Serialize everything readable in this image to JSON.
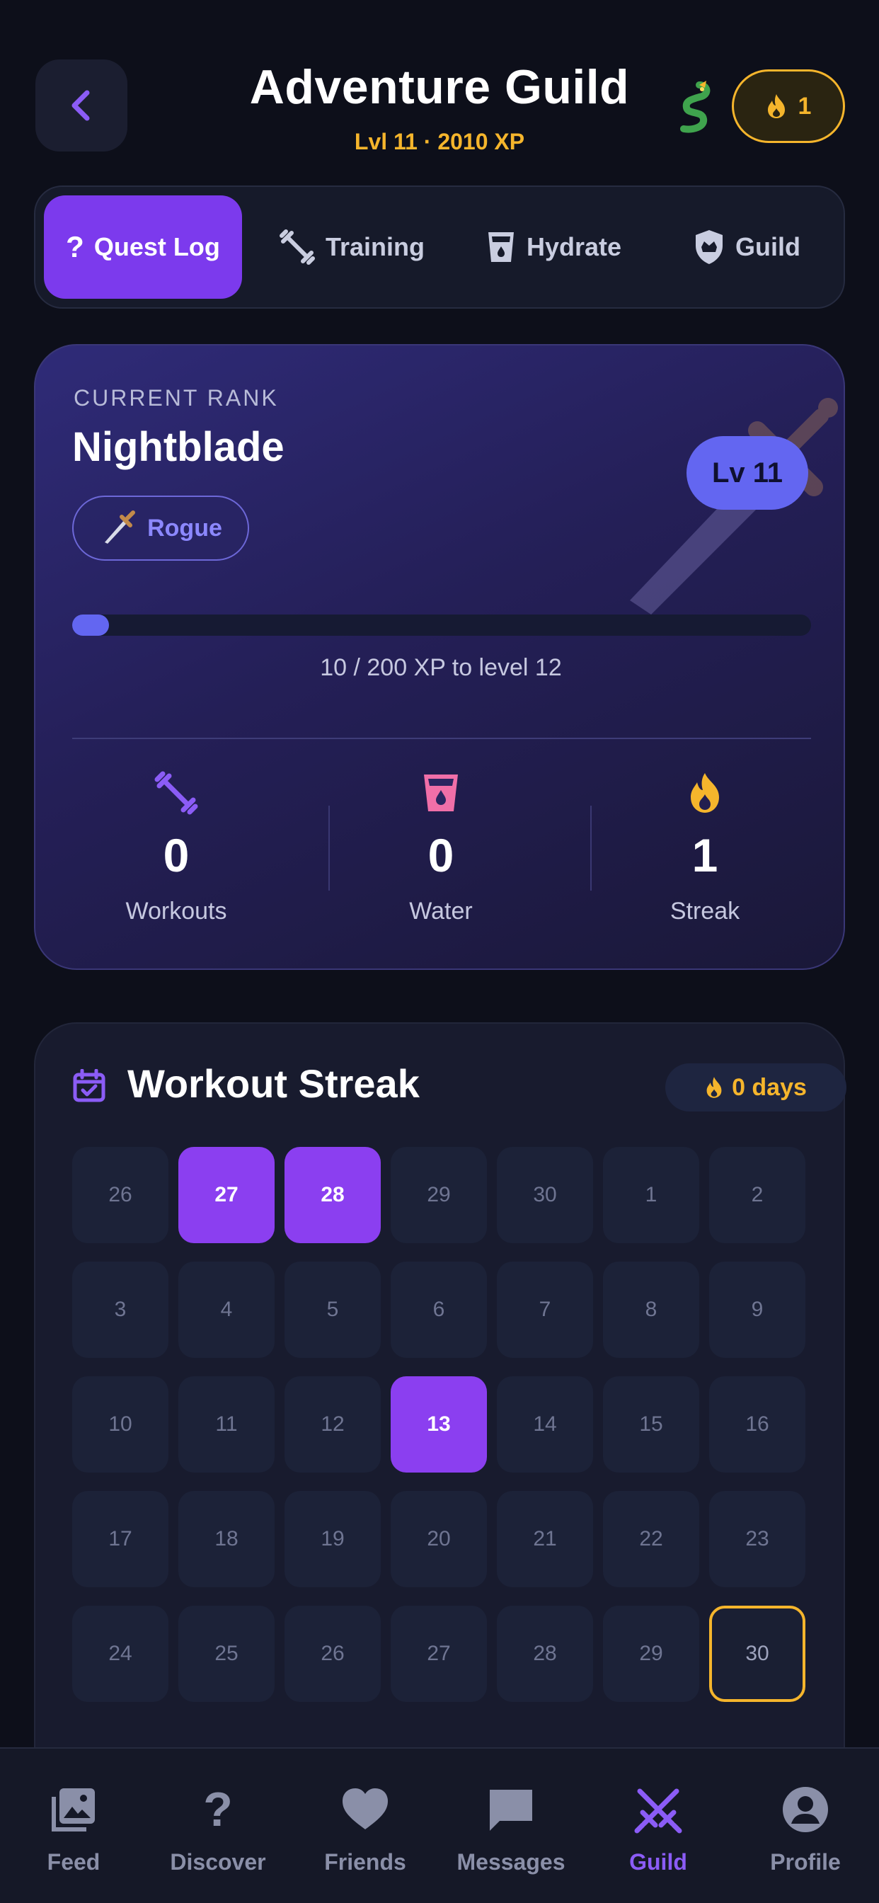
{
  "header": {
    "title": "Adventure Guild",
    "subtitle": "Lvl 11 · 2010 XP",
    "streak_count": "1"
  },
  "tabs": [
    {
      "label": "Quest Log",
      "icon": "question-icon",
      "active": true
    },
    {
      "label": "Training",
      "icon": "dumbbell-icon"
    },
    {
      "label": "Hydrate",
      "icon": "water-cup-icon"
    },
    {
      "label": "Guild",
      "icon": "shield-icon"
    }
  ],
  "rank_card": {
    "label": "CURRENT RANK",
    "rank_name": "Nightblade",
    "class_name": "Rogue",
    "level_badge": "Lv 11",
    "xp_progress_fraction": 0.05,
    "xp_text": "10 / 200 XP to level 12",
    "stats": [
      {
        "value": "0",
        "label": "Workouts",
        "icon": "dumbbell-icon",
        "color": "#8b5cf6"
      },
      {
        "value": "0",
        "label": "Water",
        "icon": "water-cup-icon",
        "color": "#f06fa8"
      },
      {
        "value": "1",
        "label": "Streak",
        "icon": "fire-icon",
        "color": "#f5b52c"
      }
    ]
  },
  "streak_card": {
    "title": "Workout Streak",
    "days_badge": "0 days",
    "calendar": [
      {
        "day": "26"
      },
      {
        "day": "27",
        "active": true
      },
      {
        "day": "28",
        "active": true
      },
      {
        "day": "29"
      },
      {
        "day": "30"
      },
      {
        "day": "1"
      },
      {
        "day": "2"
      },
      {
        "day": "3"
      },
      {
        "day": "4"
      },
      {
        "day": "5"
      },
      {
        "day": "6"
      },
      {
        "day": "7"
      },
      {
        "day": "8"
      },
      {
        "day": "9"
      },
      {
        "day": "10"
      },
      {
        "day": "11"
      },
      {
        "day": "12"
      },
      {
        "day": "13",
        "active": true
      },
      {
        "day": "14"
      },
      {
        "day": "15"
      },
      {
        "day": "16"
      },
      {
        "day": "17"
      },
      {
        "day": "18"
      },
      {
        "day": "19"
      },
      {
        "day": "20"
      },
      {
        "day": "21"
      },
      {
        "day": "22"
      },
      {
        "day": "23"
      },
      {
        "day": "24"
      },
      {
        "day": "25"
      },
      {
        "day": "26"
      },
      {
        "day": "27"
      },
      {
        "day": "28"
      },
      {
        "day": "29"
      },
      {
        "day": "30",
        "today": true
      }
    ]
  },
  "nav": [
    {
      "label": "Feed",
      "icon": "photo-icon"
    },
    {
      "label": "Discover",
      "icon": "question-icon"
    },
    {
      "label": "Friends",
      "icon": "heart-icon"
    },
    {
      "label": "Messages",
      "icon": "chat-icon"
    },
    {
      "label": "Guild",
      "icon": "crossed-swords-icon",
      "active": true
    },
    {
      "label": "Profile",
      "icon": "person-icon"
    }
  ],
  "colors": {
    "accent": "#7c3aed",
    "gold": "#f5b52c",
    "level_badge": "#6366f1",
    "background": "#0d0f1a"
  }
}
